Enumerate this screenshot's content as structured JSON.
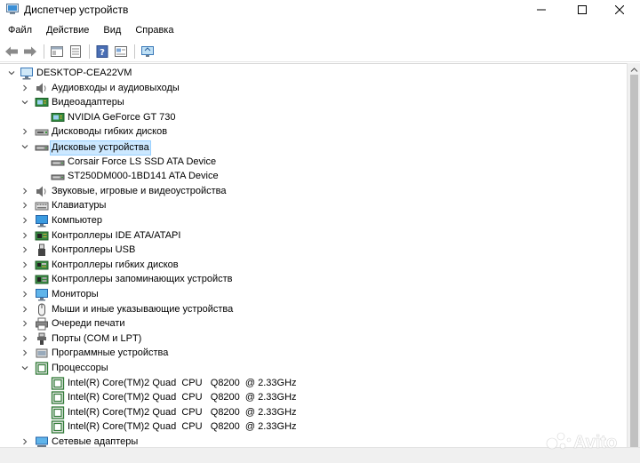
{
  "window": {
    "title": "Диспетчер устройств",
    "icon": "device-manager-icon"
  },
  "menu": {
    "items": [
      "Файл",
      "Действие",
      "Вид",
      "Справка"
    ]
  },
  "toolbar": {
    "buttons": [
      "back-arrow-icon",
      "forward-arrow-icon",
      "properties-icon",
      "list-view-icon",
      "help-icon",
      "properties-sheet-icon",
      "monitor-scan-icon"
    ]
  },
  "tree": {
    "root": "DESKTOP-CEA22VM",
    "items": [
      {
        "label": "Аудиовходы и аудиовыходы",
        "icon": "speaker-icon",
        "expanded": false
      },
      {
        "label": "Видеоадаптеры",
        "icon": "display-adapter-icon",
        "expanded": true
      },
      {
        "label": "NVIDIA GeForce GT 730",
        "icon": "display-adapter-icon",
        "child": true
      },
      {
        "label": "Дисководы гибких дисков",
        "icon": "floppy-drive-icon",
        "expanded": false
      },
      {
        "label": "Дисковые устройства",
        "icon": "disk-drive-icon",
        "expanded": true,
        "selected": true
      },
      {
        "label": "Corsair Force LS SSD ATA Device",
        "icon": "disk-drive-icon",
        "child": true
      },
      {
        "label": "ST250DM000-1BD141 ATA Device",
        "icon": "disk-drive-icon",
        "child": true
      },
      {
        "label": "Звуковые, игровые и видеоустройства",
        "icon": "speaker-icon",
        "expanded": false
      },
      {
        "label": "Клавиатуры",
        "icon": "keyboard-icon",
        "expanded": false
      },
      {
        "label": "Компьютер",
        "icon": "computer-icon",
        "expanded": false
      },
      {
        "label": "Контроллеры IDE ATA/ATAPI",
        "icon": "ide-controller-icon",
        "expanded": false
      },
      {
        "label": "Контроллеры USB",
        "icon": "usb-icon",
        "expanded": false
      },
      {
        "label": "Контроллеры гибких дисков",
        "icon": "floppy-controller-icon",
        "expanded": false
      },
      {
        "label": "Контроллеры запоминающих устройств",
        "icon": "storage-controller-icon",
        "expanded": false
      },
      {
        "label": "Мониторы",
        "icon": "monitor-icon",
        "expanded": false
      },
      {
        "label": "Мыши и иные указывающие устройства",
        "icon": "mouse-icon",
        "expanded": false
      },
      {
        "label": "Очереди печати",
        "icon": "printer-icon",
        "expanded": false
      },
      {
        "label": "Порты (COM и LPT)",
        "icon": "port-icon",
        "expanded": false
      },
      {
        "label": "Программные устройства",
        "icon": "software-device-icon",
        "expanded": false
      },
      {
        "label": "Процессоры",
        "icon": "processor-icon",
        "expanded": true
      },
      {
        "label": "Intel(R) Core(TM)2 Quad  CPU   Q8200  @ 2.33GHz",
        "icon": "processor-icon",
        "child": true
      },
      {
        "label": "Intel(R) Core(TM)2 Quad  CPU   Q8200  @ 2.33GHz",
        "icon": "processor-icon",
        "child": true
      },
      {
        "label": "Intel(R) Core(TM)2 Quad  CPU   Q8200  @ 2.33GHz",
        "icon": "processor-icon",
        "child": true
      },
      {
        "label": "Intel(R) Core(TM)2 Quad  CPU   Q8200  @ 2.33GHz",
        "icon": "processor-icon",
        "child": true
      },
      {
        "label": "Сетевые адаптеры",
        "icon": "network-adapter-icon",
        "expanded": false
      }
    ]
  },
  "watermark": {
    "text": "Avito"
  },
  "colors": {
    "selection": "#cce8ff",
    "selection_border": "#99d1ff",
    "scrollbar": "#f0f0f0"
  }
}
